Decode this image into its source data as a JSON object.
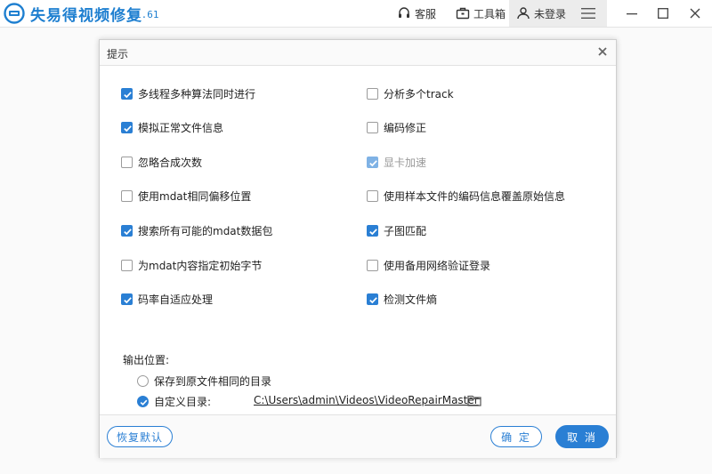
{
  "app": {
    "title": "失易得视频修复",
    "version": "1.61",
    "brand_color": "#1e7fd0"
  },
  "toolbar": {
    "support_label": "客服",
    "tools_label": "工具箱",
    "login_label": "未登录"
  },
  "dialog": {
    "title": "提示",
    "options_left": [
      {
        "label": "多线程多种算法同时进行",
        "checked": true,
        "disabled": false
      },
      {
        "label": "模拟正常文件信息",
        "checked": true,
        "disabled": false
      },
      {
        "label": "忽略合成次数",
        "checked": false,
        "disabled": false
      },
      {
        "label": "使用mdat相同偏移位置",
        "checked": false,
        "disabled": false
      },
      {
        "label": "搜索所有可能的mdat数据包",
        "checked": true,
        "disabled": false
      },
      {
        "label": "为mdat内容指定初始字节",
        "checked": false,
        "disabled": false
      },
      {
        "label": "码率自适应处理",
        "checked": true,
        "disabled": false
      }
    ],
    "options_right": [
      {
        "label": "分析多个track",
        "checked": false,
        "disabled": false
      },
      {
        "label": "编码修正",
        "checked": false,
        "disabled": false
      },
      {
        "label": "显卡加速",
        "checked": true,
        "disabled": true
      },
      {
        "label": "使用样本文件的编码信息覆盖原始信息",
        "checked": false,
        "disabled": false
      },
      {
        "label": "子图匹配",
        "checked": true,
        "disabled": false
      },
      {
        "label": "使用备用网络验证登录",
        "checked": false,
        "disabled": false
      },
      {
        "label": "检测文件熵",
        "checked": true,
        "disabled": false
      }
    ],
    "output": {
      "label": "输出位置:",
      "same_dir_label": "保存到原文件相同的目录",
      "custom_dir_label": "自定义目录:",
      "custom_path": "C:\\Users\\admin\\Videos\\VideoRepairMaster",
      "selected": "custom"
    },
    "footer": {
      "restore_label": "恢复默认",
      "ok_label": "确 定",
      "cancel_label": "取 消"
    }
  },
  "colors": {
    "accent": "#2a7fd4"
  }
}
